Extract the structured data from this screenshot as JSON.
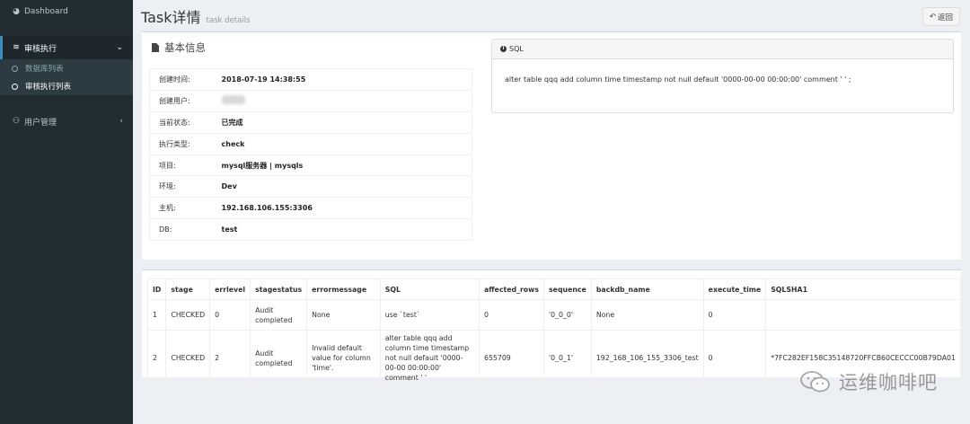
{
  "sidebar": {
    "dashboard": "Dashboard",
    "audit_exec": "审核执行",
    "sub_items": [
      "数据库列表",
      "审核执行列表"
    ],
    "user_mgmt": "用户管理"
  },
  "header": {
    "title": "Task详情",
    "subtitle": "task details",
    "back": "返回"
  },
  "info": {
    "title": "基本信息",
    "rows": [
      {
        "key": "创建时间:",
        "value": "2018-07-19 14:38:55"
      },
      {
        "key": "创建用户:",
        "value": ""
      },
      {
        "key": "当前状态:",
        "value": "已完成"
      },
      {
        "key": "执行类型:",
        "value": "check"
      },
      {
        "key": "项目:",
        "value": "mysql服务器 | mysqls"
      },
      {
        "key": "环境:",
        "value": "Dev"
      },
      {
        "key": "主机:",
        "value": "192.168.106.155:3306"
      },
      {
        "key": "DB:",
        "value": "test"
      }
    ]
  },
  "sql_panel": {
    "title": "SQL",
    "text": "alter table qqq add column time timestamp not null default '0000-00-00 00:00:00' comment ' ' ;"
  },
  "results": {
    "headers": [
      "ID",
      "stage",
      "errlevel",
      "stagestatus",
      "errormessage",
      "SQL",
      "affected_rows",
      "sequence",
      "backdb_name",
      "execute_time",
      "SQLSHA1"
    ],
    "rows": [
      [
        "1",
        "CHECKED",
        "0",
        "Audit completed",
        "None",
        "use `test`",
        "0",
        "'0_0_0'",
        "None",
        "0",
        ""
      ],
      [
        "2",
        "CHECKED",
        "2",
        "Audit completed",
        "Invalid default value for column 'time'.",
        "alter table qqq add column time timestamp not null default '0000-00-00 00:00:00' comment ' '",
        "655709",
        "'0_0_1'",
        "192_168_106_155_3306_test",
        "0",
        "*7FC282EF158C35148720FFCB60CECCC00B79DA01"
      ]
    ]
  },
  "watermark": "运维咖啡吧"
}
